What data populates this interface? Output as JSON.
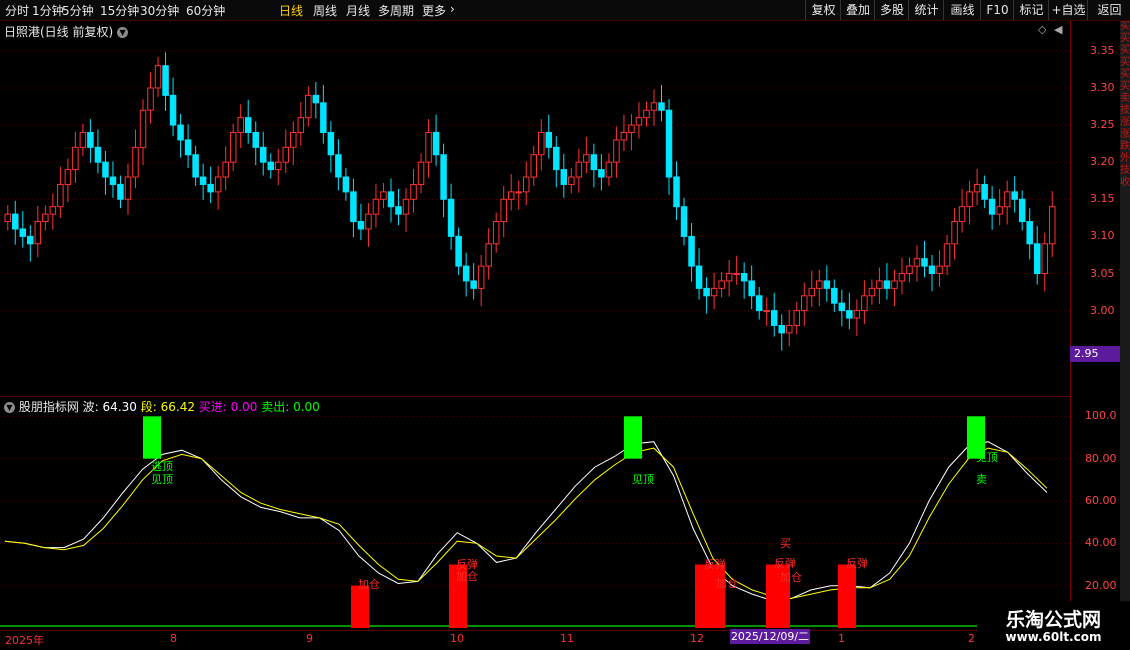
{
  "topbar": {
    "periods": [
      {
        "label": "分时",
        "active": false
      },
      {
        "label": "1分钟",
        "active": false
      },
      {
        "label": "5分钟",
        "active": false
      },
      {
        "label": "15分钟",
        "active": false
      },
      {
        "label": "30分钟",
        "active": false
      },
      {
        "label": "60分钟",
        "active": false
      },
      {
        "label": "日线",
        "active": true
      },
      {
        "label": "周线",
        "active": false
      },
      {
        "label": "月线",
        "active": false
      },
      {
        "label": "多周期",
        "active": false
      },
      {
        "label": "更多",
        "active": false
      }
    ],
    "tools": [
      "复权",
      "叠加",
      "多股",
      "统计",
      "画线",
      "F10",
      "标记",
      "+自选",
      "返回"
    ]
  },
  "main_panel": {
    "title": "日照港(日线 前复权)",
    "price_ticks": [
      "3.35",
      "3.30",
      "3.25",
      "3.20",
      "3.15",
      "3.10",
      "3.05",
      "3.00"
    ],
    "current_price_tag": "2.95"
  },
  "indicator_panel": {
    "name": "股朋指标网",
    "wave_label": "波:",
    "wave_value": "64.30",
    "segment_label": "段:",
    "segment_value": "66.42",
    "buy_label": "买进:",
    "buy_value": "0.00",
    "sell_label": "卖出:",
    "sell_value": "0.00",
    "ticks": [
      "100.0",
      "80.00",
      "60.00",
      "40.00",
      "20.00"
    ],
    "signals": [
      "逃顶",
      "见顶",
      "卖",
      "反弹",
      "加仓",
      "买"
    ]
  },
  "x_axis": {
    "labels": [
      "2025年",
      "8",
      "9",
      "10",
      "11",
      "12",
      "1",
      "2"
    ],
    "cursor_date": "2025/12/09/二"
  },
  "right_strip_chars": [
    "买",
    "买",
    "买",
    "买",
    "买",
    "买",
    "卖",
    "技",
    "涨",
    "涨",
    "跌",
    "外",
    "技",
    "收"
  ],
  "watermark": {
    "line1": "乐淘公式网",
    "line2": "www.60lt.com"
  },
  "colors": {
    "up": "#ff3232",
    "down": "#00e5ff",
    "wave_line": "#ffffff",
    "segment_line": "#ffff00",
    "buy_bar": "#ff0000",
    "sell_bar": "#00ff00",
    "buy_text": "#ff00ff",
    "sell_text": "#00ff00"
  },
  "chart_data": [
    {
      "type": "candlestick",
      "title": "日照港(日线 前复权)",
      "ylim": [
        2.92,
        3.37
      ],
      "closes": [
        3.13,
        3.11,
        3.1,
        3.09,
        3.12,
        3.13,
        3.14,
        3.17,
        3.19,
        3.22,
        3.24,
        3.22,
        3.2,
        3.18,
        3.17,
        3.15,
        3.18,
        3.22,
        3.27,
        3.3,
        3.33,
        3.29,
        3.25,
        3.23,
        3.21,
        3.18,
        3.17,
        3.16,
        3.18,
        3.2,
        3.24,
        3.26,
        3.24,
        3.22,
        3.2,
        3.19,
        3.2,
        3.22,
        3.24,
        3.26,
        3.29,
        3.28,
        3.24,
        3.21,
        3.18,
        3.16,
        3.12,
        3.11,
        3.13,
        3.15,
        3.16,
        3.14,
        3.13,
        3.15,
        3.17,
        3.2,
        3.24,
        3.21,
        3.15,
        3.1,
        3.06,
        3.04,
        3.03,
        3.06,
        3.09,
        3.12,
        3.15,
        3.16,
        3.16,
        3.18,
        3.21,
        3.24,
        3.22,
        3.19,
        3.17,
        3.18,
        3.2,
        3.21,
        3.19,
        3.18,
        3.2,
        3.23,
        3.24,
        3.25,
        3.26,
        3.27,
        3.28,
        3.27,
        3.18,
        3.14,
        3.1,
        3.06,
        3.03,
        3.02,
        3.03,
        3.04,
        3.05,
        3.05,
        3.04,
        3.02,
        3.0,
        3.0,
        2.98,
        2.97,
        2.98,
        3.0,
        3.02,
        3.03,
        3.04,
        3.03,
        3.01,
        3.0,
        2.99,
        3.0,
        3.02,
        3.03,
        3.04,
        3.03,
        3.04,
        3.05,
        3.06,
        3.07,
        3.06,
        3.05,
        3.06,
        3.09,
        3.12,
        3.14,
        3.16,
        3.17,
        3.15,
        3.13,
        3.14,
        3.16,
        3.15,
        3.12,
        3.09,
        3.05,
        3.09,
        3.14
      ]
    },
    {
      "type": "line",
      "title": "股朋指标网",
      "ylim": [
        0,
        100
      ],
      "series": [
        {
          "name": "波",
          "values": [
            41,
            40,
            38,
            38,
            42,
            52,
            64,
            75,
            82,
            84,
            80,
            70,
            62,
            57,
            55,
            52,
            52,
            46,
            34,
            26,
            21,
            22,
            35,
            45,
            40,
            31,
            33,
            45,
            56,
            67,
            76,
            81,
            87,
            88,
            72,
            47,
            28,
            20,
            16,
            13,
            14,
            18,
            20,
            20,
            19,
            26,
            40,
            60,
            76,
            86,
            88,
            83,
            73,
            64
          ]
        },
        {
          "name": "段",
          "values": [
            41,
            40,
            38,
            37,
            39,
            47,
            58,
            70,
            79,
            82,
            80,
            72,
            64,
            59,
            56,
            54,
            52,
            49,
            39,
            30,
            23,
            22,
            31,
            41,
            40,
            34,
            33,
            42,
            51,
            61,
            70,
            77,
            83,
            85,
            76,
            54,
            33,
            23,
            18,
            15,
            14,
            16,
            18,
            19,
            19,
            23,
            34,
            52,
            68,
            80,
            85,
            83,
            75,
            66
          ]
        }
      ]
    }
  ]
}
